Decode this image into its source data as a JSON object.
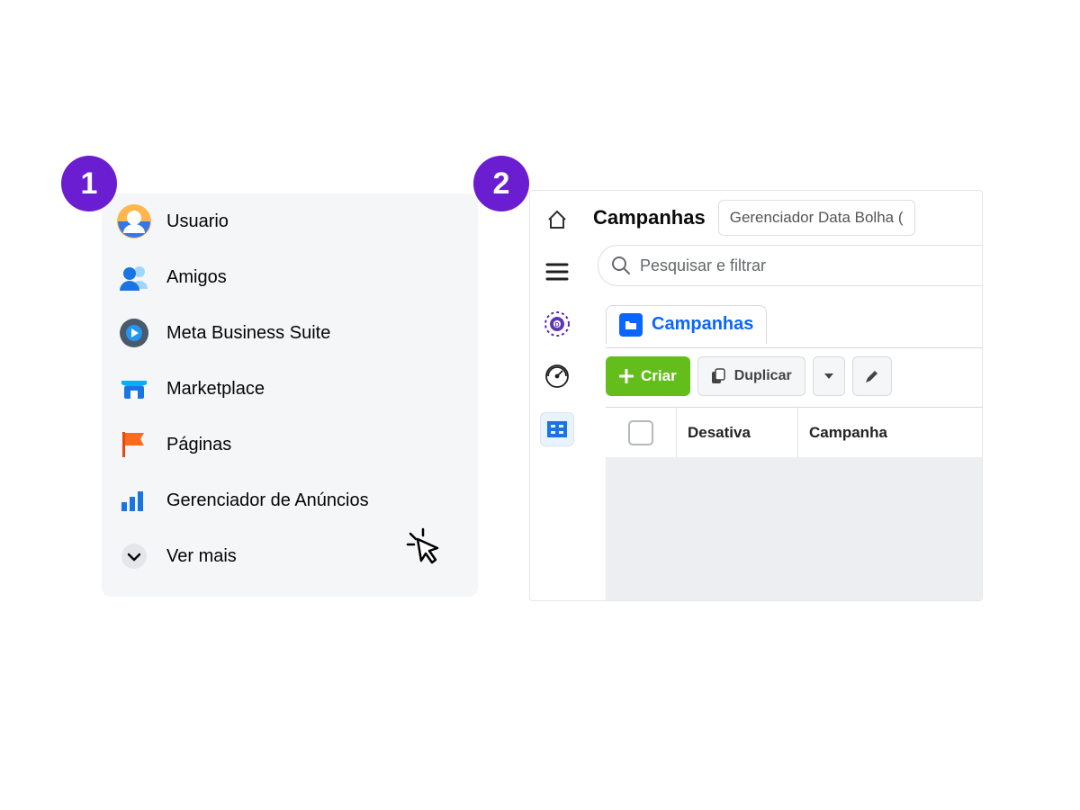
{
  "steps": {
    "one": "1",
    "two": "2"
  },
  "sidebar_menu": {
    "items": [
      {
        "id": "user",
        "label": "Usuario"
      },
      {
        "id": "amigos",
        "label": "Amigos"
      },
      {
        "id": "meta",
        "label": "Meta Business Suite"
      },
      {
        "id": "marketplace",
        "label": "Marketplace"
      },
      {
        "id": "paginas",
        "label": "Páginas"
      },
      {
        "id": "ads",
        "label": "Gerenciador de Anúncios"
      },
      {
        "id": "vermais",
        "label": "Ver mais"
      }
    ]
  },
  "ads_manager": {
    "page_title": "Campanhas",
    "account_selector": "Gerenciador Data Bolha (",
    "search_placeholder": "Pesquisar e filtrar",
    "tab_label": "Campanhas",
    "create_label": "Criar",
    "duplicate_label": "Duplicar",
    "table_columns": {
      "c1": "Desativa",
      "c2": "Campanha"
    }
  }
}
